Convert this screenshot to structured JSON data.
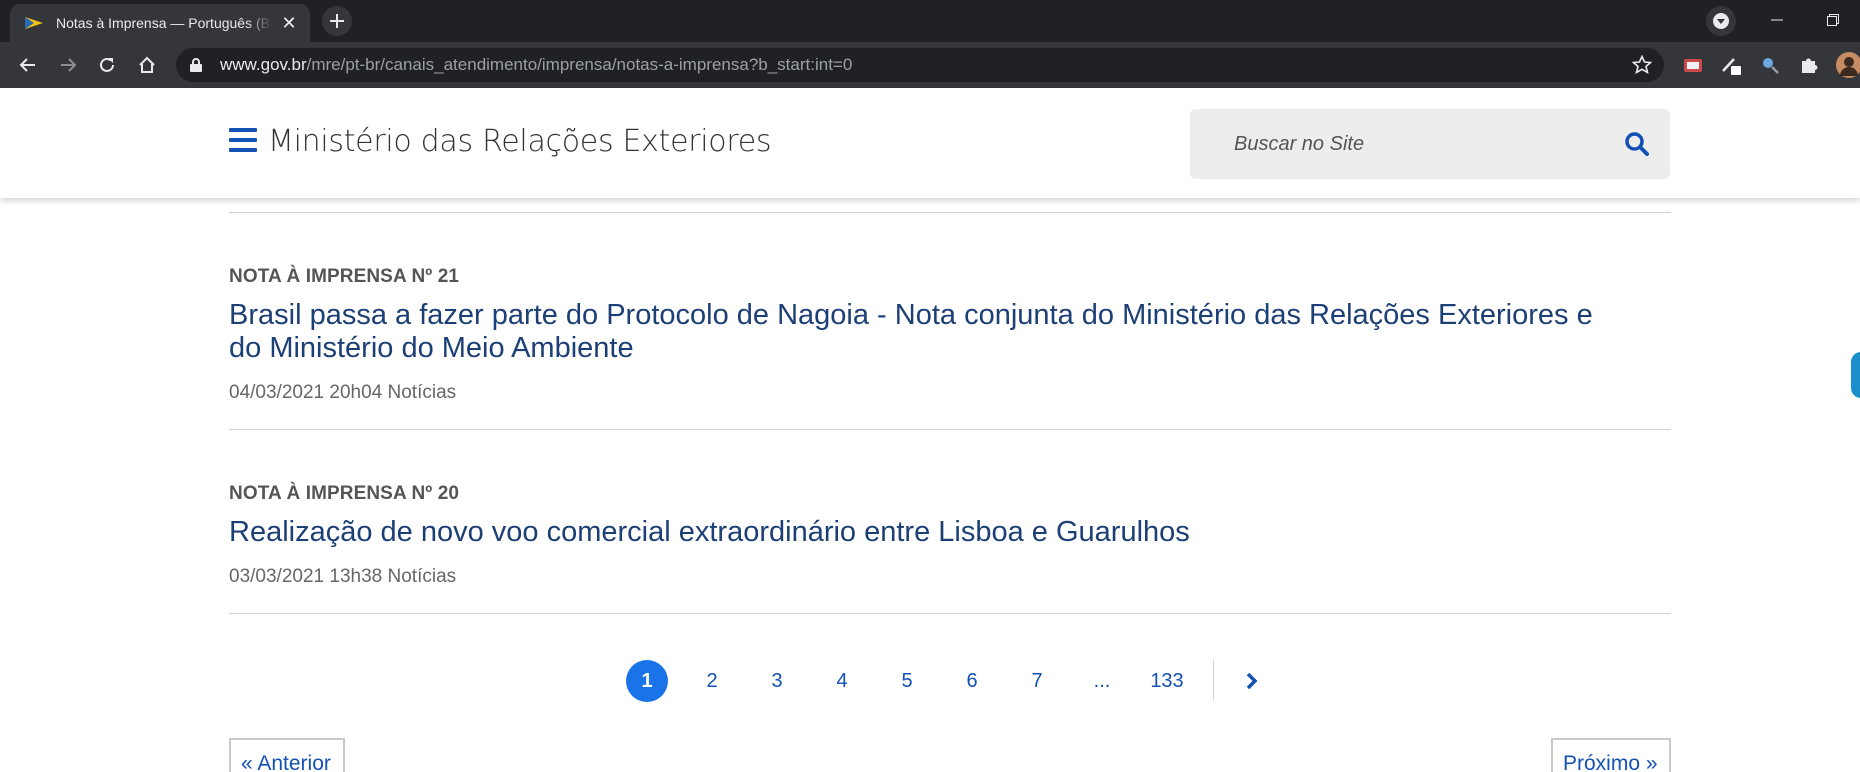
{
  "browser": {
    "tab_title": "Notas à Imprensa — Português (Brasil)",
    "url_host": "www.gov.br",
    "url_path": "/mre/pt-br/canais_atendimento/imprensa/notas-a-imprensa?b_start:int=0"
  },
  "header": {
    "site_title": "Ministério das Relações Exteriores",
    "search_placeholder": "Buscar no Site"
  },
  "news": [
    {
      "kicker": "NOTA À IMPRENSA Nº 21",
      "title": "Brasil passa a fazer parte do Protocolo de Nagoia - Nota conjunta do Ministério das Relações Exteriores e do Ministério do Meio Ambiente",
      "date": "04/03/2021 20h04",
      "category": "Notícias"
    },
    {
      "kicker": "NOTA À IMPRENSA Nº 20",
      "title": "Realização de novo voo comercial extraordinário entre Lisboa e Guarulhos",
      "date": "03/03/2021 13h38",
      "category": "Notícias"
    }
  ],
  "pagination": {
    "pages": [
      "1",
      "2",
      "3",
      "4",
      "5",
      "6",
      "7",
      "...",
      "133"
    ],
    "current": "1",
    "previous_label": "« Anterior",
    "next_label": "Próximo »"
  },
  "colors": {
    "brand_blue": "#1351b4",
    "headline_blue": "#1c3f76",
    "active_page": "#1a73e8"
  }
}
